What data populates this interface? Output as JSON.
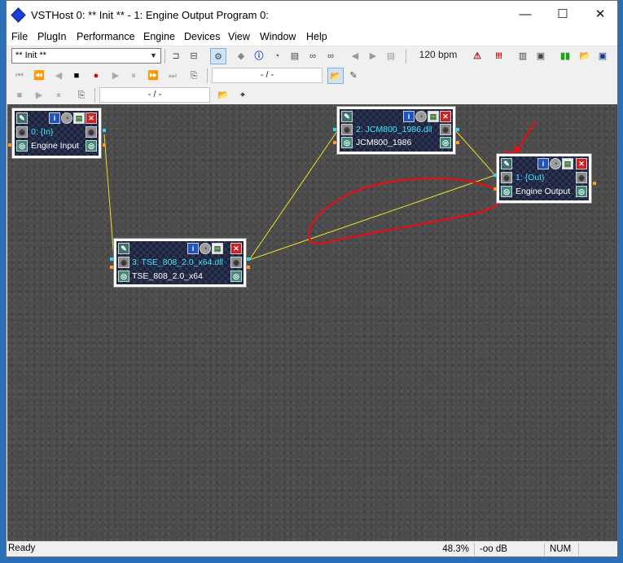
{
  "window": {
    "title": "VSTHost 0: ** Init ** - 1: Engine Output Program 0:",
    "controls": {
      "minimize": "—",
      "maximize": "☐",
      "close": "✕"
    }
  },
  "menu": [
    "File",
    "PlugIn",
    "Performance",
    "Engine",
    "Devices",
    "View",
    "Window",
    "Help"
  ],
  "toolbar1": {
    "program_combo": "** Init **",
    "bpm": "120 bpm"
  },
  "toolbar2": {
    "position": "- / -"
  },
  "toolbar3": {
    "position": "- / -"
  },
  "nodes": {
    "engine_input": {
      "top": "0: {In}",
      "bottom": "Engine Input"
    },
    "jcm800": {
      "top": "2: JCM800_1986.dll",
      "bottom": "JCM800_1986"
    },
    "engine_output": {
      "top": "1: {Out}",
      "bottom": "Engine Output"
    },
    "tse808": {
      "top": "3: TSE_808_2.0_x64.dll",
      "bottom": "TSE_808_2.0_x64"
    }
  },
  "icons": {
    "edit": "✎",
    "info": "i",
    "bypass": "◔",
    "volume": "▤",
    "close": "✕"
  },
  "statusbar": {
    "state": "Ready",
    "cpu": "48.3%",
    "level": "-oo dB",
    "num": "NUM"
  },
  "colors": {
    "wire": "#e8e020",
    "annotation": "#d8141a",
    "node_label": "#3fe6ff"
  }
}
